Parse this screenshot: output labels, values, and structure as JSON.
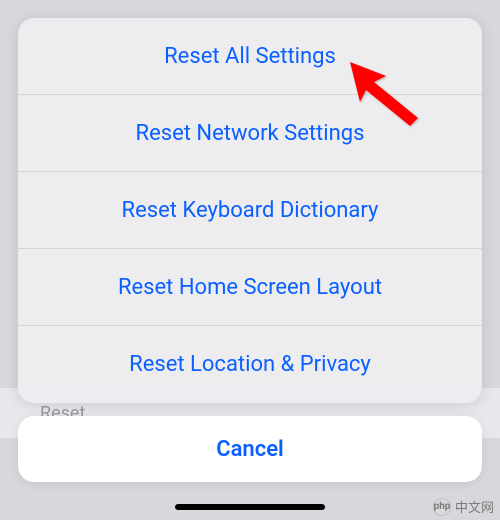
{
  "background": {
    "peek_row_label": "Reset"
  },
  "sheet": {
    "options": [
      {
        "label": "Reset All Settings"
      },
      {
        "label": "Reset Network Settings"
      },
      {
        "label": "Reset Keyboard Dictionary"
      },
      {
        "label": "Reset Home Screen Layout"
      },
      {
        "label": "Reset Location & Privacy"
      }
    ],
    "cancel_label": "Cancel"
  },
  "annotation": {
    "arrow_color": "#ff0000"
  },
  "watermark": {
    "logo_text": "php",
    "text": "中文网"
  }
}
